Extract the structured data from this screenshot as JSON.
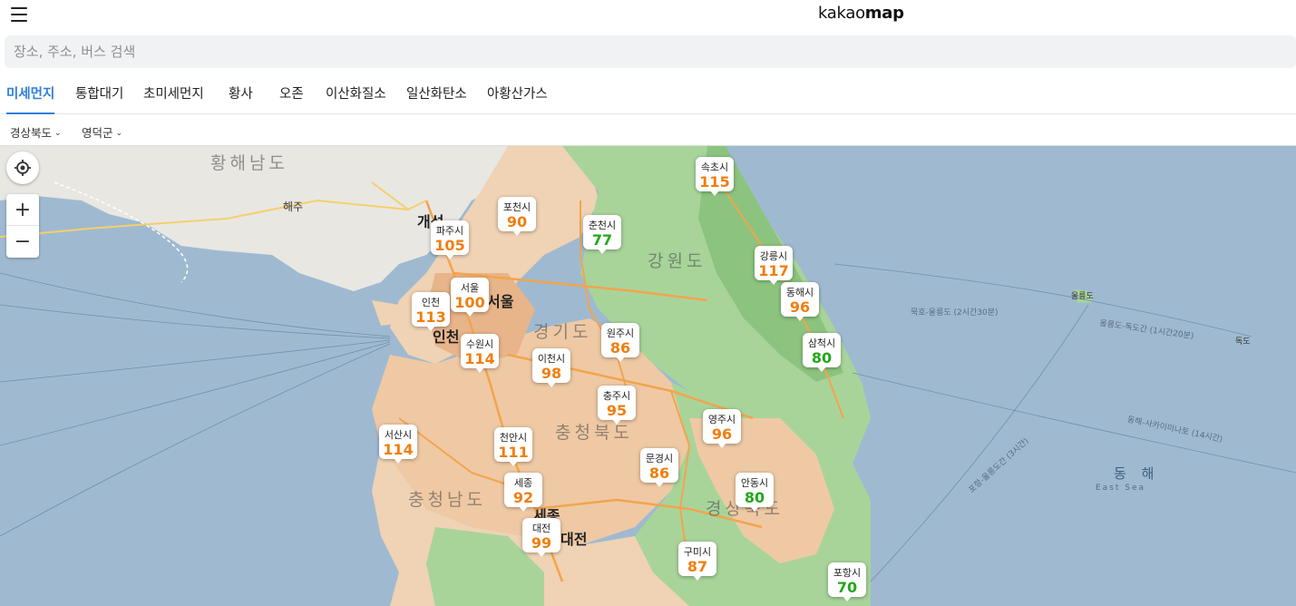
{
  "header": {
    "logo_light": "kakao",
    "logo_bold": "map"
  },
  "search": {
    "placeholder": "장소, 주소, 버스 검색"
  },
  "tabs": [
    {
      "label": "미세먼지",
      "active": true
    },
    {
      "label": "통합대기",
      "active": false
    },
    {
      "label": "초미세먼지",
      "active": false
    },
    {
      "label": "황사",
      "active": false
    },
    {
      "label": "오존",
      "active": false
    },
    {
      "label": "이산화질소",
      "active": false
    },
    {
      "label": "일산화탄소",
      "active": false
    },
    {
      "label": "아황산가스",
      "active": false
    }
  ],
  "filters": {
    "province": "경상북도",
    "county": "영덕군"
  },
  "colors": {
    "active_tab": "#2f7fd8",
    "moderate": "#f07e0f",
    "good": "#22a81b"
  },
  "icons": [
    "menu-icon",
    "gps-icon",
    "zoom-in-icon",
    "zoom-out-icon",
    "chevron-down-icon"
  ],
  "zoom": {
    "in": "+",
    "out": "−"
  },
  "map_labels": {
    "hwanghae": "황해남도",
    "gangwon": "강원도",
    "gyeonggi": "경기도",
    "chungbuk": "충청북도",
    "chungnam": "충청남도",
    "gyeongbuk": "경상북도",
    "east_sea": "동 해",
    "east_sea_en": "East Sea",
    "ulleungdo": "울릉도",
    "dokdo": "독도",
    "gaeseong": "개성",
    "seoul": "서울",
    "incheon": "인천",
    "sejong": "세종",
    "daejeon": "대전",
    "haeju": "해주",
    "route1": "묵호-울릉도 (2시간30분)",
    "route2": "울릉도-독도간 (1시간20분)",
    "route3": "동해-사카이미나토 (14시간)",
    "route4": "포항-울릉도간 (3시간)"
  },
  "stations": [
    {
      "name": "속초시",
      "value": "115",
      "level": "moderate"
    },
    {
      "name": "포천시",
      "value": "90",
      "level": "moderate"
    },
    {
      "name": "춘천시",
      "value": "77",
      "level": "good"
    },
    {
      "name": "파주시",
      "value": "105",
      "level": "moderate"
    },
    {
      "name": "강릉시",
      "value": "117",
      "level": "moderate"
    },
    {
      "name": "서울",
      "value": "100",
      "level": "moderate"
    },
    {
      "name": "인천",
      "value": "113",
      "level": "moderate"
    },
    {
      "name": "동해시",
      "value": "96",
      "level": "moderate"
    },
    {
      "name": "원주시",
      "value": "86",
      "level": "moderate"
    },
    {
      "name": "수원시",
      "value": "114",
      "level": "moderate"
    },
    {
      "name": "삼척시",
      "value": "80",
      "level": "good"
    },
    {
      "name": "이천시",
      "value": "98",
      "level": "moderate"
    },
    {
      "name": "충주시",
      "value": "95",
      "level": "moderate"
    },
    {
      "name": "영주시",
      "value": "96",
      "level": "moderate"
    },
    {
      "name": "서산시",
      "value": "114",
      "level": "moderate"
    },
    {
      "name": "천안시",
      "value": "111",
      "level": "moderate"
    },
    {
      "name": "문경시",
      "value": "86",
      "level": "moderate"
    },
    {
      "name": "세종",
      "value": "92",
      "level": "moderate"
    },
    {
      "name": "안동시",
      "value": "80",
      "level": "good"
    },
    {
      "name": "대전",
      "value": "99",
      "level": "moderate"
    },
    {
      "name": "구미시",
      "value": "87",
      "level": "moderate"
    },
    {
      "name": "포항시",
      "value": "70",
      "level": "good"
    }
  ]
}
